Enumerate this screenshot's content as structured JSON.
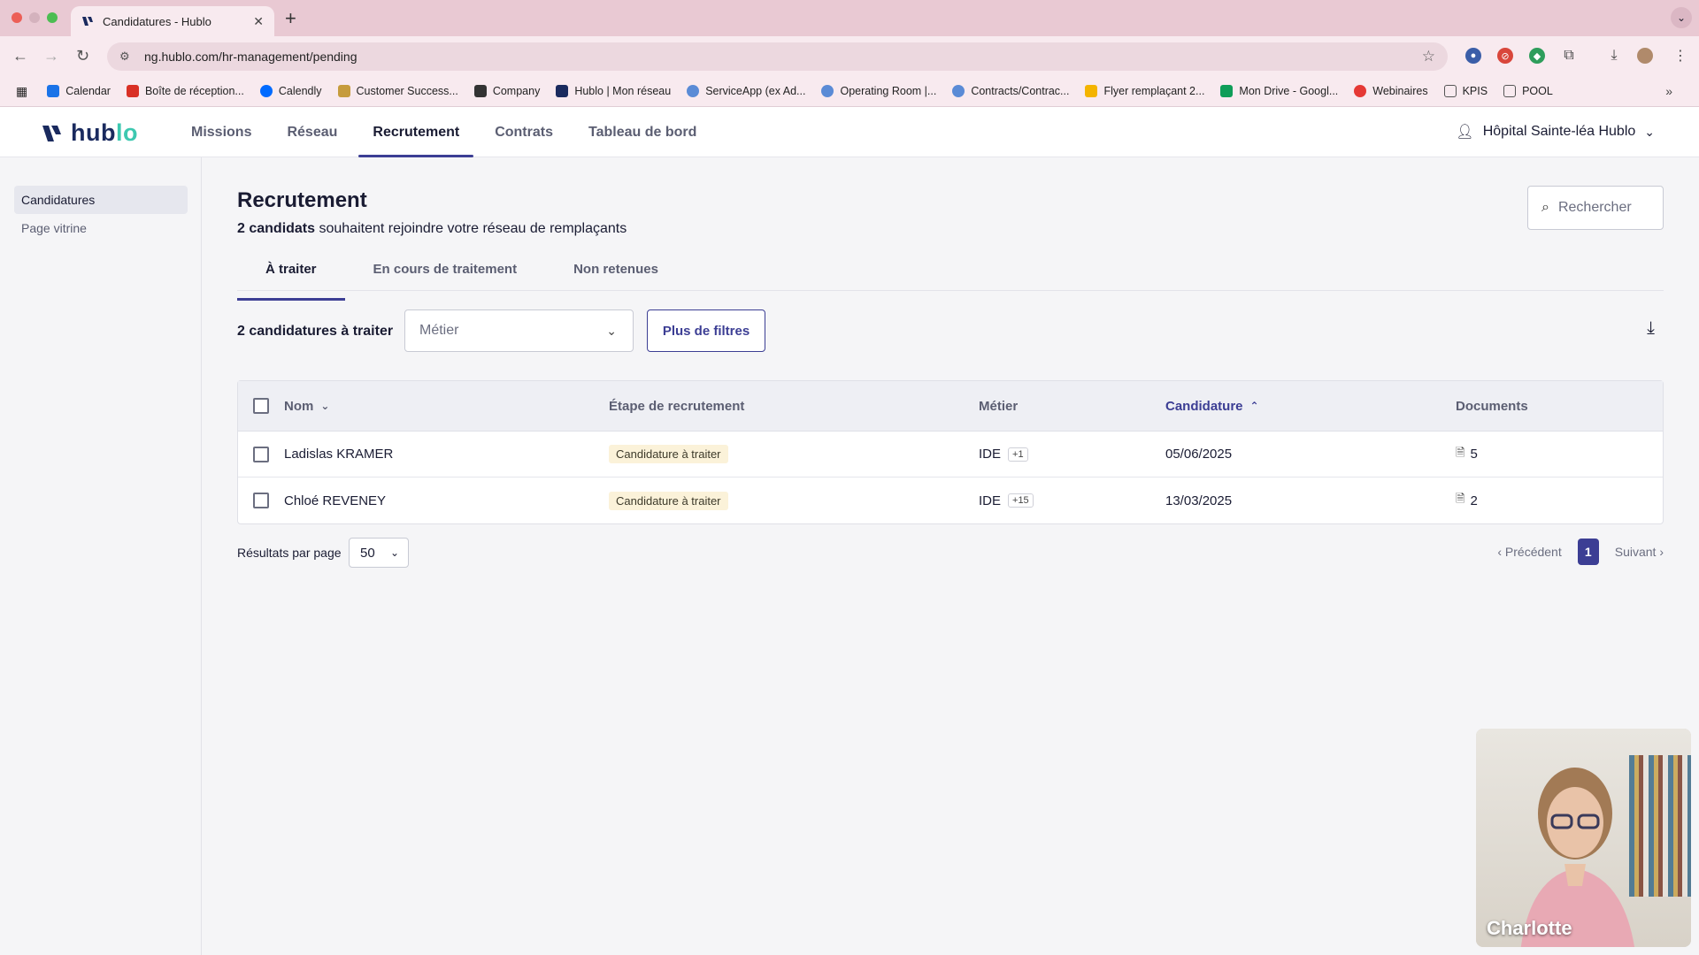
{
  "browser": {
    "tab_title": "Candidatures - Hublo",
    "url": "ng.hublo.com/hr-management/pending",
    "bookmarks": [
      {
        "label": "Calendar",
        "icon": "calendar-icon",
        "color": "#1a73e8"
      },
      {
        "label": "Boîte de réception...",
        "icon": "gmail-icon",
        "color": "#d93025"
      },
      {
        "label": "Calendly",
        "icon": "calendly-icon",
        "color": "#006bff"
      },
      {
        "label": "Customer Success...",
        "icon": "notion-icon",
        "color": "#c69c3d"
      },
      {
        "label": "Company",
        "icon": "company-icon",
        "color": "#333333"
      },
      {
        "label": "Hublo | Mon réseau",
        "icon": "hublo-icon",
        "color": "#1a2a5e"
      },
      {
        "label": "ServiceApp (ex Ad...",
        "icon": "gem-icon",
        "color": "#5a8bd6"
      },
      {
        "label": "Operating Room |...",
        "icon": "gem-icon",
        "color": "#5a8bd6"
      },
      {
        "label": "Contracts/Contrac...",
        "icon": "gem-icon",
        "color": "#5a8bd6"
      },
      {
        "label": "Flyer remplaçant 2...",
        "icon": "slides-icon",
        "color": "#f4b400"
      },
      {
        "label": "Mon Drive - Googl...",
        "icon": "drive-icon",
        "color": "#0f9d58"
      },
      {
        "label": "Webinaires",
        "icon": "webinar-icon",
        "color": "#e53935"
      },
      {
        "label": "KPIS",
        "icon": "folder-icon",
        "color": "#555555"
      },
      {
        "label": "POOL",
        "icon": "folder-icon",
        "color": "#555555"
      }
    ]
  },
  "app": {
    "logo_main": "hub",
    "logo_accent": "lo",
    "nav": [
      "Missions",
      "Réseau",
      "Recrutement",
      "Contrats",
      "Tableau de bord"
    ],
    "account": "Hôpital Sainte-léa Hublo",
    "brand_color": "#3c3e94",
    "accent_color": "#3dc8b0"
  },
  "sidebar": {
    "items": [
      "Candidatures",
      "Page vitrine"
    ]
  },
  "main": {
    "title": "Recrutement",
    "subtitle_bold": "2 candidats",
    "subtitle_rest": " souhaitent rejoindre votre réseau de remplaçants",
    "search_placeholder": "Rechercher",
    "tabs": [
      "À traiter",
      "En cours de traitement",
      "Non retenues"
    ],
    "count_label": "2 candidatures à traiter",
    "metier_placeholder": "Métier",
    "filters_button": "Plus de filtres"
  },
  "table": {
    "headers": {
      "nom": "Nom",
      "etape": "Étape de recrutement",
      "metier": "Métier",
      "candidature": "Candidature",
      "documents": "Documents"
    },
    "rows": [
      {
        "nom": "Ladislas KRAMER",
        "etape": "Candidature à traiter",
        "metier": "IDE",
        "metier_extra": "+1",
        "date": "05/06/2025",
        "docs": "5"
      },
      {
        "nom": "Chloé REVENEY",
        "etape": "Candidature à traiter",
        "metier": "IDE",
        "metier_extra": "+15",
        "date": "13/03/2025",
        "docs": "2"
      }
    ]
  },
  "pagination": {
    "per_page_label": "Résultats par page",
    "per_page_value": "50",
    "prev": "Précédent",
    "current": "1",
    "next": "Suivant"
  },
  "video": {
    "participant_name": "Charlotte"
  }
}
